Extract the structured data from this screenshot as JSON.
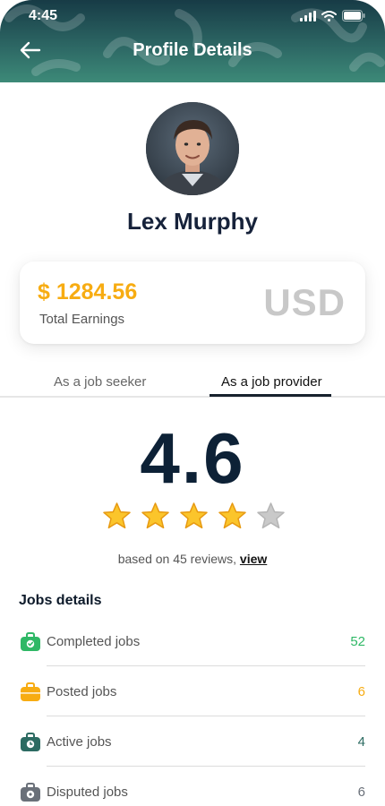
{
  "status_bar": {
    "time": "4:45"
  },
  "header": {
    "title": "Profile Details"
  },
  "profile": {
    "name": "Lex Murphy"
  },
  "earnings": {
    "amount": "$ 1284.56",
    "label": "Total Earnings",
    "currency": "USD"
  },
  "tabs": [
    {
      "label": "As a job seeker",
      "active": false
    },
    {
      "label": "As a job provider",
      "active": true
    }
  ],
  "rating": {
    "value": "4.6",
    "stars_filled": 4,
    "stars_total": 5,
    "reviews_text": "based on 45 reviews,",
    "view_label": "view"
  },
  "jobs": {
    "title": "Jobs details",
    "items": [
      {
        "label": "Completed jobs",
        "count": "52",
        "color": "#2fb866",
        "icon": "briefcase-check-icon"
      },
      {
        "label": "Posted jobs",
        "count": "6",
        "color": "#f7ac12",
        "icon": "briefcase-icon"
      },
      {
        "label": "Active jobs",
        "count": "4",
        "color": "#2c6b62",
        "icon": "briefcase-clock-icon"
      },
      {
        "label": "Disputed jobs",
        "count": "6",
        "color": "#6a7079",
        "icon": "briefcase-alert-icon"
      }
    ]
  },
  "colors": {
    "header": "#1f4e55",
    "accent": "#f7ac12",
    "success": "#2fb866"
  }
}
